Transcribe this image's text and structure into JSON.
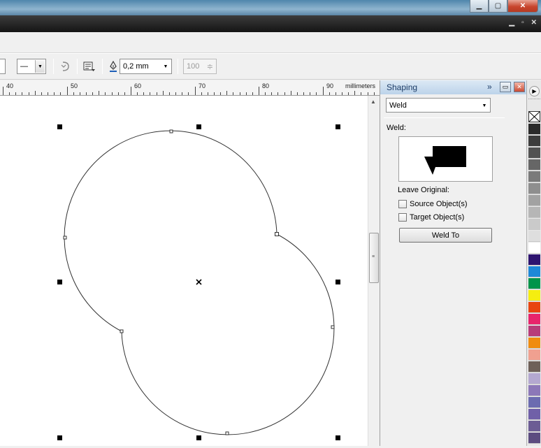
{
  "window": {
    "title_buttons": {
      "minimize": "▁",
      "restore": "▢",
      "close": "✕"
    },
    "doc_buttons": {
      "minimize": "▁",
      "restore": "▫",
      "close": "✕"
    }
  },
  "property_bar": {
    "outline_style": "—",
    "outline_width": "0,2 mm",
    "node_count": "100",
    "icons": [
      "reverse-direction-icon",
      "wrap-icon",
      "outline-pen-icon",
      "nudge-icon"
    ]
  },
  "ruler": {
    "unit_label": "millimeters",
    "major_labels": [
      "40",
      "50",
      "60",
      "70",
      "80",
      "90"
    ]
  },
  "docker": {
    "title": "Shaping",
    "expand_icon": "»",
    "operation_selected": "Weld",
    "operation_label": "Weld:",
    "leave_original_label": "Leave Original:",
    "source_option": "Source Object(s)",
    "target_option": "Target Object(s)",
    "source_checked": false,
    "target_checked": false,
    "action_button": "Weld To"
  },
  "palette": {
    "colors": [
      "#2b2b2b",
      "#3d3d3d",
      "#525252",
      "#666666",
      "#7a7a7a",
      "#8e8e8e",
      "#a2a2a2",
      "#b6b6b6",
      "#cacaca",
      "#dedede",
      "#ffffff",
      "#2e1470",
      "#1e88d8",
      "#00944a",
      "#f5ee10",
      "#e84410",
      "#e8246c",
      "#b83c7a",
      "#f08c10",
      "#f0a090",
      "#6e6058",
      "#b4a8d0",
      "#8c78b8",
      "#6c6cb0",
      "#7060a8",
      "#6c5c94",
      "#5c4c80"
    ]
  }
}
